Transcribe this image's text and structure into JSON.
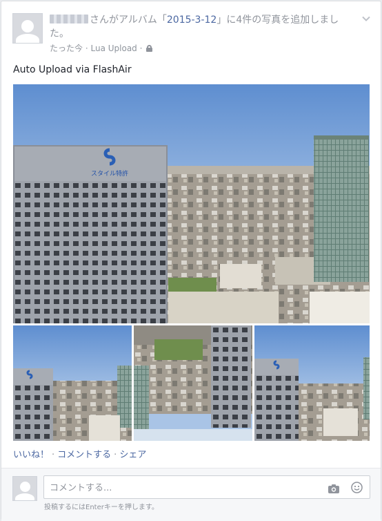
{
  "post": {
    "story_before_album": "さんがアルバム「",
    "album_name": "2015-3-12",
    "story_after_album": "」に4件の写真を追加しました。",
    "timestamp": "たった今",
    "separator": "·",
    "app_name": "Lua Upload",
    "message": "Auto Upload via FlashAir"
  },
  "photos": {
    "main_caption": "スタイル特許",
    "alt": [
      "photo-1",
      "photo-2",
      "photo-3",
      "photo-4"
    ]
  },
  "actions": {
    "like": "いいね！",
    "comment": "コメントする",
    "share": "シェア",
    "separator": "·"
  },
  "comment": {
    "placeholder": "コメントする...",
    "hint": "投稿するにはEnterキーを押します。"
  },
  "icons": {
    "chevron": "chevron-down-icon",
    "lock": "lock-icon",
    "camera": "camera-icon",
    "emoji": "smiley-icon"
  },
  "colors": {
    "link": "#4b67a1",
    "meta": "#90949c",
    "sky": "#7fa6d8"
  }
}
